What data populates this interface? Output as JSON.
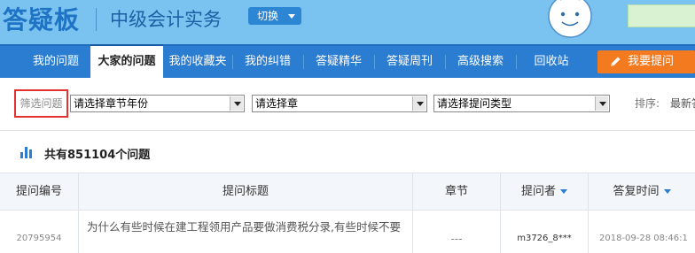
{
  "header": {
    "logo": "答疑板",
    "subject": "中级会计实务",
    "switch_label": "切换"
  },
  "nav": {
    "items": [
      {
        "label": "我的问题"
      },
      {
        "label": "大家的问题",
        "active": true
      },
      {
        "label": "我的收藏夹"
      },
      {
        "label": "我的纠错"
      },
      {
        "label": "答疑精华"
      },
      {
        "label": "答疑周刊"
      },
      {
        "label": "高级搜索"
      },
      {
        "label": "回收站"
      }
    ],
    "ask_button": "我要提问"
  },
  "filters": {
    "label": "筛选问题",
    "year_select": "请选择章节年份",
    "chapter_select": "请选择章",
    "type_select": "请选择提问类型",
    "sort_label": "排序:",
    "sort_value": "最新答"
  },
  "summary": {
    "count_text": "共有851104个问题"
  },
  "table": {
    "headers": {
      "id": "提问编号",
      "title": "提问标题",
      "chapter": "章节",
      "asker": "提问者",
      "time": "答复时间"
    },
    "rows": [
      {
        "id": "20795954",
        "title": "为什么有些时候在建工程领用产品要做消费税分录,有些时候不要",
        "chapter": "---",
        "asker": "m3726_8***",
        "time": "2018-09-28 08:46:1"
      }
    ]
  },
  "colors": {
    "header_bg": "#7ac2f0",
    "nav_bg": "#2a7dd1",
    "ask_button": "#f47a20",
    "highlight_border": "#e2312f"
  }
}
